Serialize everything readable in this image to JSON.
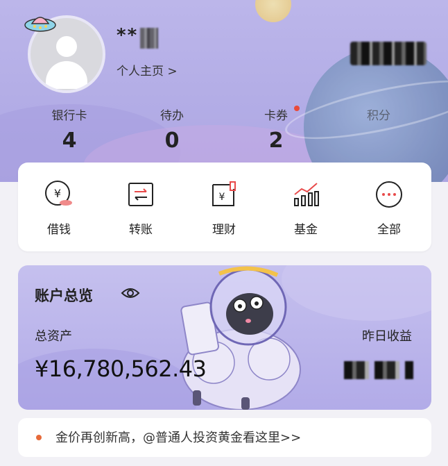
{
  "profile": {
    "name": "**",
    "homepage_link": "个人主页 >"
  },
  "stats": [
    {
      "label": "银行卡",
      "value": "4",
      "badge": false
    },
    {
      "label": "待办",
      "value": "0",
      "badge": false
    },
    {
      "label": "卡券",
      "value": "2",
      "badge": true
    },
    {
      "label": "积分",
      "value": "",
      "badge": false
    }
  ],
  "grid": [
    {
      "label": "借钱",
      "icon": "yen-coin-icon"
    },
    {
      "label": "转账",
      "icon": "transfer-icon"
    },
    {
      "label": "理财",
      "icon": "wealth-doc-icon"
    },
    {
      "label": "基金",
      "icon": "fund-chart-icon"
    },
    {
      "label": "全部",
      "icon": "more-dots-icon"
    }
  ],
  "overview": {
    "title": "账户总览",
    "total_label": "总资产",
    "total_value": "¥16,780,562.43",
    "yesterday_label": "昨日收益"
  },
  "notice": {
    "text": "金价再创新高，@普通人投资黄金看这里>>"
  },
  "colors": {
    "accent_red": "#e94a3a",
    "hero_bg": "#b3ade6",
    "overview_bg": "#b9b2ea"
  }
}
